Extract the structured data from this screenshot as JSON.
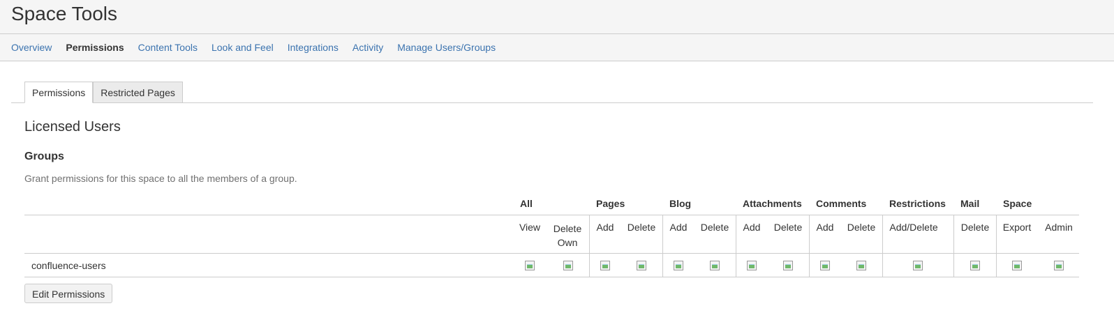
{
  "header": {
    "title": "Space Tools"
  },
  "nav": {
    "items": [
      {
        "label": "Overview",
        "active": false
      },
      {
        "label": "Permissions",
        "active": true
      },
      {
        "label": "Content Tools",
        "active": false
      },
      {
        "label": "Look and Feel",
        "active": false
      },
      {
        "label": "Integrations",
        "active": false
      },
      {
        "label": "Activity",
        "active": false
      },
      {
        "label": "Manage Users/Groups",
        "active": false
      }
    ]
  },
  "subtabs": [
    {
      "label": "Permissions",
      "active": true
    },
    {
      "label": "Restricted Pages",
      "active": false
    }
  ],
  "section": {
    "title": "Licensed Users",
    "groups_heading": "Groups",
    "groups_description": "Grant permissions for this space to all the members of a group."
  },
  "table": {
    "groups": [
      "All",
      "Pages",
      "Blog",
      "Attachments",
      "Comments",
      "Restrictions",
      "Mail",
      "Space"
    ],
    "columns": {
      "all_view": "View",
      "all_delete_own": "Delete Own",
      "pages_add": "Add",
      "pages_delete": "Delete",
      "blog_add": "Add",
      "blog_delete": "Delete",
      "att_add": "Add",
      "att_delete": "Delete",
      "com_add": "Add",
      "com_delete": "Delete",
      "restrictions_add_delete": "Add/Delete",
      "mail_delete": "Delete",
      "space_export": "Export",
      "space_admin": "Admin"
    },
    "rows": [
      {
        "name": "confluence-users"
      }
    ]
  },
  "actions": {
    "edit_permissions": "Edit Permissions"
  },
  "colors": {
    "link": "#3b73af",
    "border": "#cccccc",
    "header_bg": "#f5f5f5"
  }
}
